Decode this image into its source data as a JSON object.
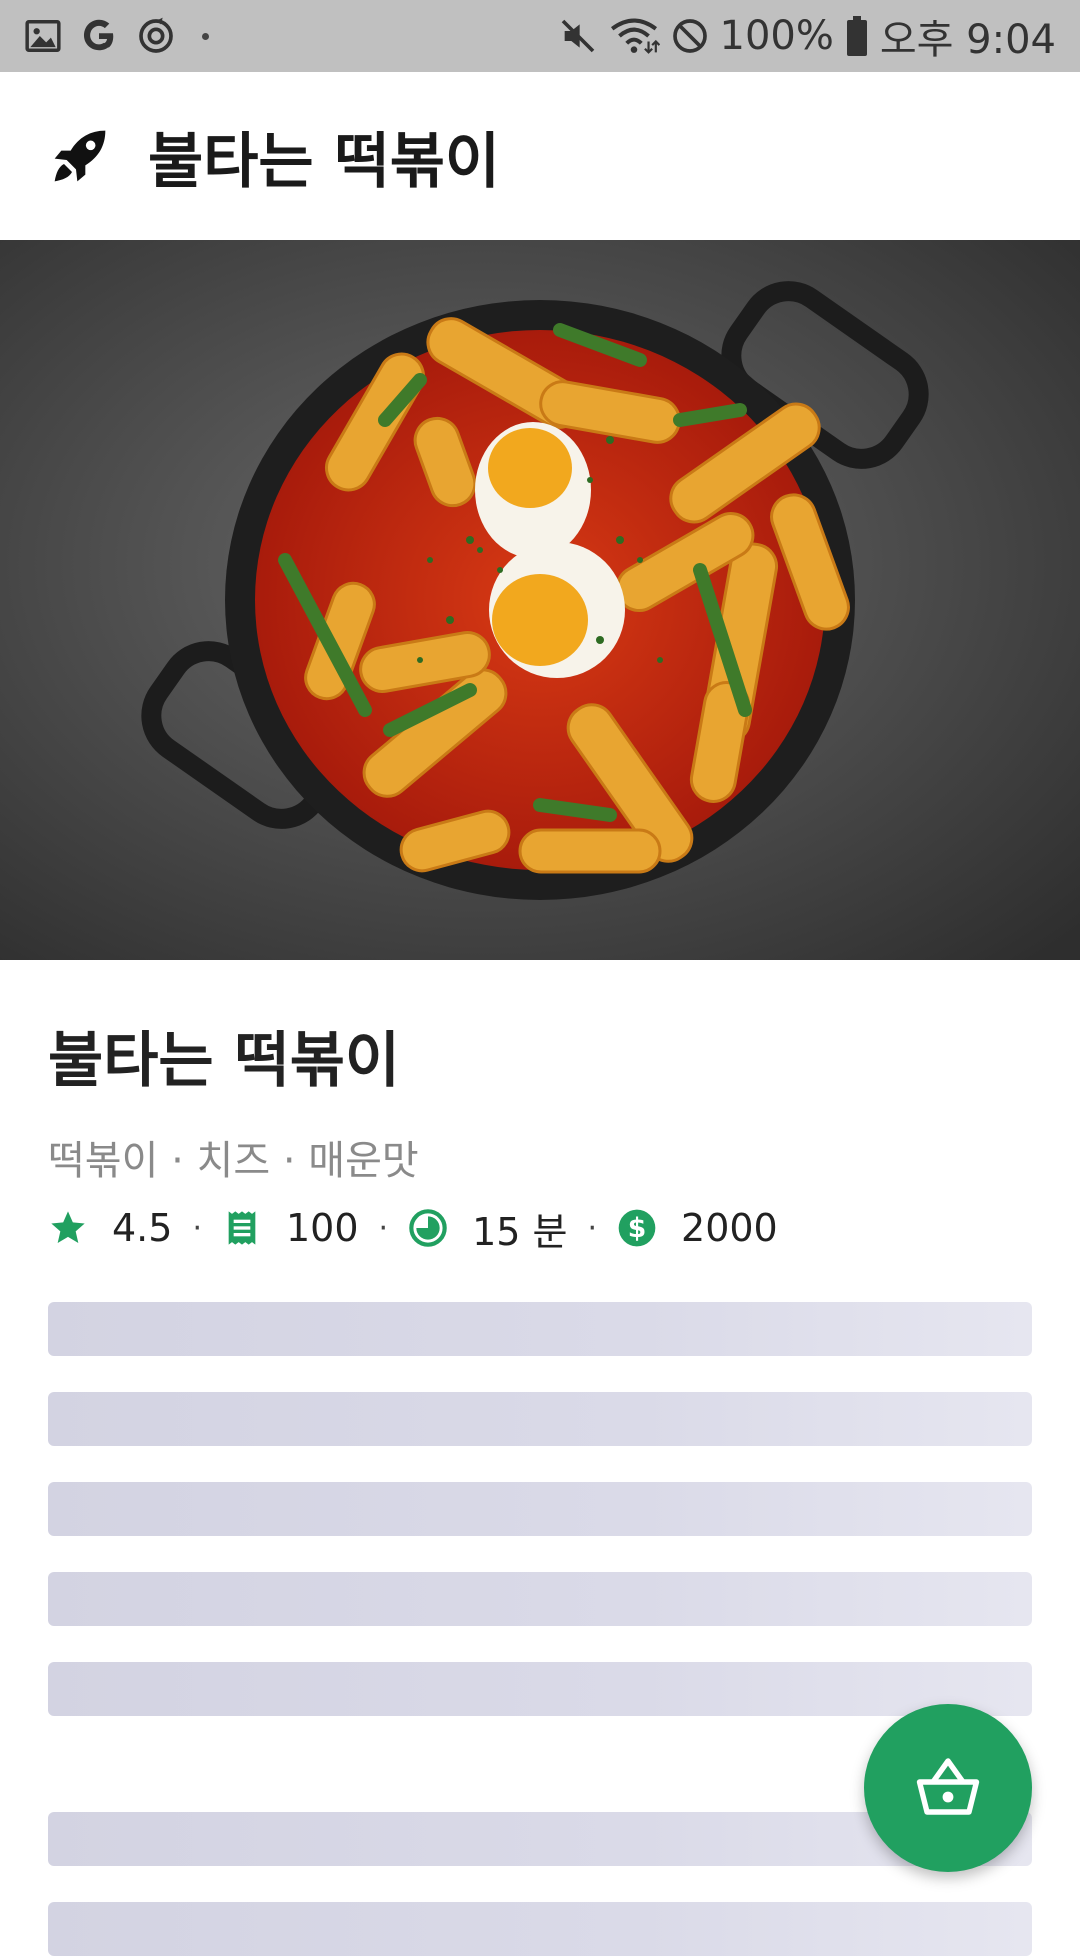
{
  "status_bar": {
    "battery": "100%",
    "time": "오후 9:04",
    "icons_left": [
      "gallery-icon",
      "google-icon",
      "sync-icon"
    ],
    "icons_right": [
      "mute-icon",
      "wifi-icon",
      "do-not-disturb-icon",
      "battery-icon"
    ]
  },
  "app_bar": {
    "icon": "rocket-icon",
    "title": "불타는 떡볶이"
  },
  "item": {
    "title": "불타는 떡볶이",
    "tags": "떡볶이 · 치즈 · 매운맛",
    "rating": "4.5",
    "reviews": "100",
    "time": "15 분",
    "price": "2000",
    "separator": "·"
  },
  "colors": {
    "accent": "#21a060",
    "status_bar": "#c0c0c0",
    "skeleton": "#d8d8e6"
  },
  "fab": {
    "icon": "basket-icon"
  }
}
